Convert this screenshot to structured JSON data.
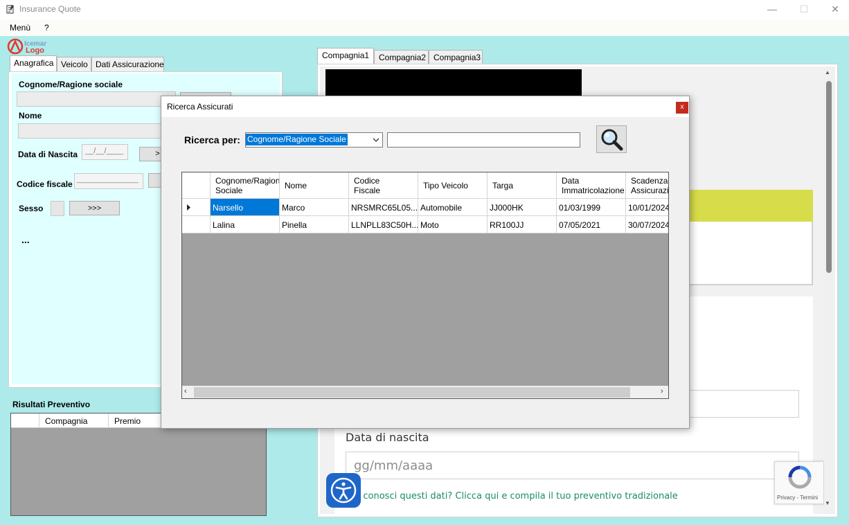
{
  "window": {
    "title": "Insurance Quote",
    "minimize": "—",
    "maximize": "☐",
    "close": "✕"
  },
  "menu": {
    "items": [
      "Menù",
      "?"
    ]
  },
  "logo": {
    "text_top": "Icemar",
    "text_bottom": "Logo"
  },
  "left_panel": {
    "tabs": [
      "Anagrafica",
      "Veicolo",
      "Dati Assicurazione"
    ],
    "active_tab": 0,
    "fields": {
      "surname_label": "Cognome/Ragione sociale",
      "name_label": "Nome",
      "birth_label": "Data di Nascita",
      "birth_value": "__/__/____",
      "fiscal_label": "Codice fiscale",
      "fiscal_value": "________________",
      "sex_label": "Sesso",
      "sex_button": ">>>",
      "more": "..."
    },
    "results": {
      "title": "Risultati Preventivo",
      "columns": [
        "",
        "Compagnia",
        "Premio"
      ]
    }
  },
  "right_panel": {
    "tabs": [
      "Compagnia1",
      "Compagnia2",
      "Compagnia3"
    ],
    "active_tab": 0,
    "web": {
      "dob_label": "Data di nascita",
      "dob_placeholder": "gg/mm/aaaa",
      "link_text": "n conosci questi dati? Clicca qui e compila il tuo preventivo tradizionale",
      "recaptcha_text": "Privacy - Termini"
    }
  },
  "dialog": {
    "title": "Ricerca Assicurati",
    "close": "x",
    "search_label": "Ricerca per:",
    "search_field": "Cognome/Ragione Sociale",
    "search_value": "",
    "columns": [
      [
        "Cognome/Ragione",
        "Sociale"
      ],
      [
        "Nome",
        ""
      ],
      [
        "Codice",
        "Fiscale"
      ],
      [
        "Tipo Veicolo",
        ""
      ],
      [
        "Targa",
        ""
      ],
      [
        "Data",
        "Immatricolazione"
      ],
      [
        "Scadenza",
        "Assicurazione"
      ]
    ],
    "rows": [
      [
        "Narsello",
        "Marco",
        "NRSMRC65L05...",
        "Automobile",
        "JJ000HK",
        "01/03/1999",
        "10/01/2024"
      ],
      [
        "Lalina",
        "Pinella",
        "LLNPLL83C50H...",
        "Moto",
        "RR100JJ",
        "07/05/2021",
        "30/07/2024"
      ]
    ],
    "selected_row": 0
  },
  "colors": {
    "background": "#aeeaea",
    "selection": "#0078d7",
    "close_red": "#c42b1c",
    "yellow_card": "#d7dc4a",
    "link": "#1a8a6e"
  }
}
